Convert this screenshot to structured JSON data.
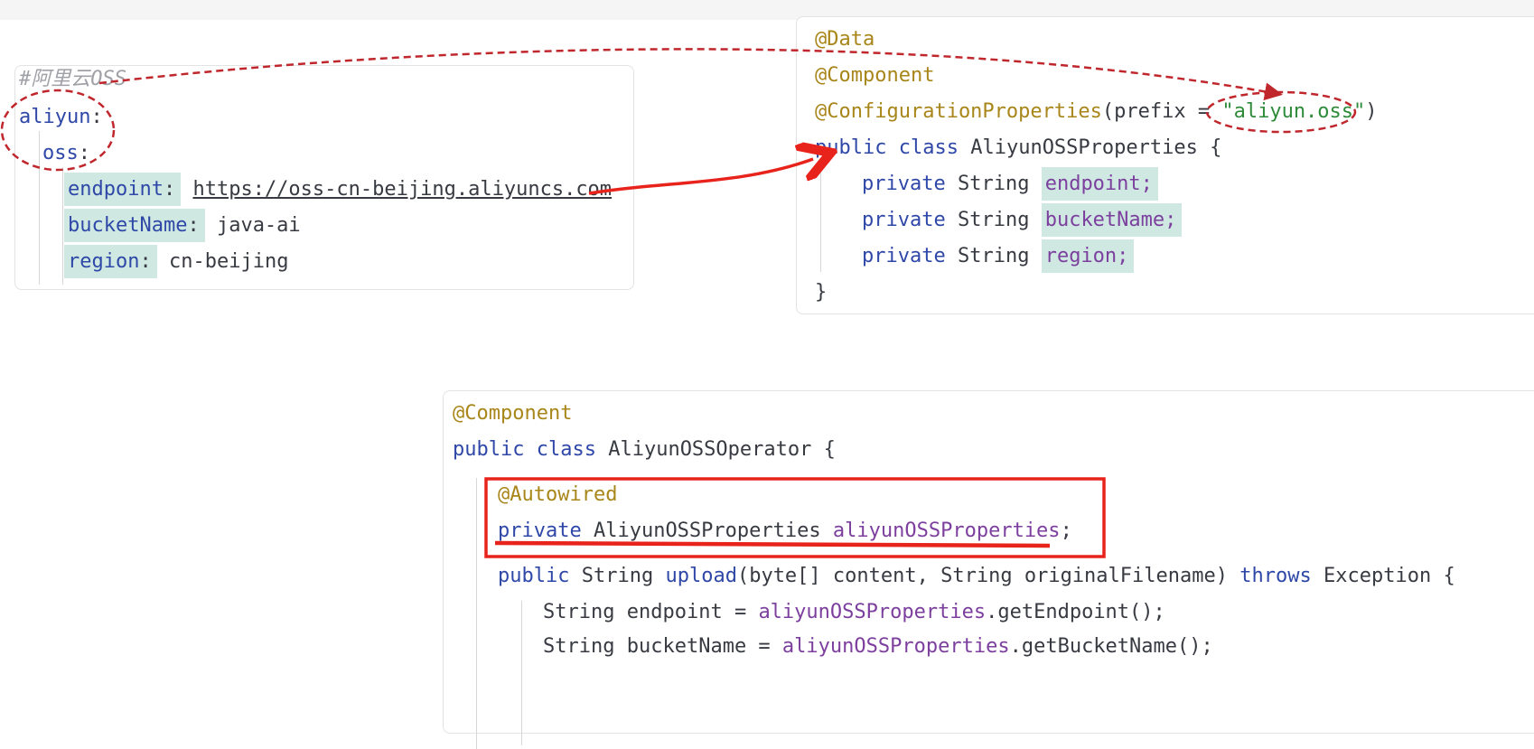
{
  "yaml": {
    "comment": "#阿里云OSS",
    "root_key": "aliyun",
    "child_key": "oss",
    "colon": ":",
    "entries": [
      {
        "key": "endpoint",
        "value": "https://oss-cn-beijing.aliyuncs.com"
      },
      {
        "key": "bucketName",
        "value": "java-ai"
      },
      {
        "key": "region",
        "value": "cn-beijing"
      }
    ]
  },
  "properties_class": {
    "ann_data": "@Data",
    "ann_component": "@Component",
    "ann_config": "@ConfigurationProperties",
    "config_args_open": "(prefix = ",
    "prefix_value": "\"aliyun.oss\"",
    "config_args_close": ")",
    "kw_public": "public",
    "kw_class": "class",
    "class_name": "AliyunOSSProperties",
    "open_brace": "{",
    "close_brace": "}",
    "kw_private": "private",
    "type": "String",
    "fields": [
      "endpoint;",
      "bucketName;",
      "region;"
    ]
  },
  "operator_class": {
    "ann_component": "@Component",
    "kw_public": "public",
    "kw_class": "class",
    "class_name": "AliyunOSSOperator",
    "open_brace": "{",
    "ann_autowired": "@Autowired",
    "kw_private": "private",
    "field_type": "AliyunOSSProperties",
    "field_name": "aliyunOSSProperties",
    "semicolon": ";",
    "method_kw": "public",
    "method_type": "String",
    "method_name": "upload",
    "method_params": "(byte[] content, String originalFilename)",
    "throws_kw": "throws",
    "exception": "Exception {",
    "body_type": "String",
    "var_endpoint": "endpoint = ",
    "getter_endpoint": ".getEndpoint();",
    "var_bucket": "bucketName = ",
    "getter_bucket": ".getBucketName();"
  },
  "annotation_colors": {
    "dashed_circle": "#c0272d",
    "arrow": "#e8231c",
    "highlight_box": "#e8231c"
  }
}
